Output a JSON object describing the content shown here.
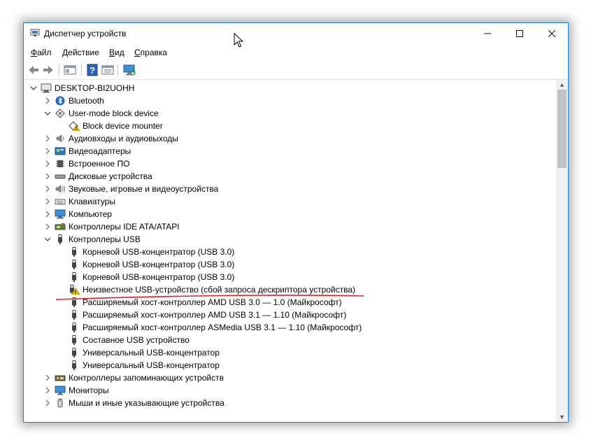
{
  "window": {
    "title": "Диспетчер устройств",
    "minimize_glyph": "—",
    "maximize_glyph": "☐",
    "close_glyph": "✕"
  },
  "menu": [
    {
      "label_pre": "",
      "label_u": "Ф",
      "label_post": "айл"
    },
    {
      "label_pre": "",
      "label_u": "Д",
      "label_post": "ействие"
    },
    {
      "label_pre": "",
      "label_u": "В",
      "label_post": "ид"
    },
    {
      "label_pre": "",
      "label_u": "С",
      "label_post": "правка"
    }
  ],
  "toolbar_icons": [
    "back-icon",
    "forward-icon",
    "properties-window-icon",
    "help-icon",
    "view-icon",
    "monitor-scan-icon"
  ],
  "tree": {
    "root": "DESKTOP-BI2UOHH",
    "items": [
      {
        "level": 1,
        "expander": "collapsed",
        "icon": "bluetooth-icon",
        "label": "Bluetooth"
      },
      {
        "level": 1,
        "expander": "expanded",
        "icon": "block-device-icon",
        "label": "User-mode block device"
      },
      {
        "level": 2,
        "expander": "none",
        "icon": "block-device-warning-icon",
        "label": "Block device mounter"
      },
      {
        "level": 1,
        "expander": "collapsed",
        "icon": "speaker-icon",
        "label": "Аудиовходы и аудиовыходы"
      },
      {
        "level": 1,
        "expander": "collapsed",
        "icon": "display-adapter-icon",
        "label": "Видеоадаптеры"
      },
      {
        "level": 1,
        "expander": "collapsed",
        "icon": "chip-icon",
        "label": "Встроенное ПО"
      },
      {
        "level": 1,
        "expander": "collapsed",
        "icon": "disk-drive-icon",
        "label": "Дисковые устройства"
      },
      {
        "level": 1,
        "expander": "collapsed",
        "icon": "sound-icon",
        "label": "Звуковые, игровые и видеоустройства"
      },
      {
        "level": 1,
        "expander": "collapsed",
        "icon": "keyboard-icon",
        "label": "Клавиатуры"
      },
      {
        "level": 1,
        "expander": "collapsed",
        "icon": "computer-icon",
        "label": "Компьютер"
      },
      {
        "level": 1,
        "expander": "collapsed",
        "icon": "ide-controller-icon",
        "label": "Контроллеры IDE ATA/ATAPI"
      },
      {
        "level": 1,
        "expander": "expanded",
        "icon": "usb-plug-icon",
        "label": "Контроллеры USB"
      },
      {
        "level": 2,
        "expander": "none",
        "icon": "usb-plug-icon",
        "label": "Корневой USB-концентратор (USB 3.0)"
      },
      {
        "level": 2,
        "expander": "none",
        "icon": "usb-plug-icon",
        "label": "Корневой USB-концентратор (USB 3.0)"
      },
      {
        "level": 2,
        "expander": "none",
        "icon": "usb-plug-icon",
        "label": "Корневой USB-концентратор (USB 3.0)"
      },
      {
        "level": 2,
        "expander": "none",
        "icon": "usb-warning-icon",
        "label": "Неизвестное USB-устройство (сбой запроса дескриптора устройства)"
      },
      {
        "level": 2,
        "expander": "none",
        "icon": "usb-plug-icon",
        "label": "Расширяемый хост-контроллер AMD USB 3.0 — 1.0 (Майкрософт)"
      },
      {
        "level": 2,
        "expander": "none",
        "icon": "usb-plug-icon",
        "label": "Расширяемый хост-контроллер AMD USB 3.1 — 1.10 (Майкрософт)"
      },
      {
        "level": 2,
        "expander": "none",
        "icon": "usb-plug-icon",
        "label": "Расширяемый хост-контроллер ASMedia USB 3.1 — 1.10 (Майкрософт)"
      },
      {
        "level": 2,
        "expander": "none",
        "icon": "usb-plug-icon",
        "label": "Составное USB устройство"
      },
      {
        "level": 2,
        "expander": "none",
        "icon": "usb-plug-icon",
        "label": "Универсальный USB-концентратор"
      },
      {
        "level": 2,
        "expander": "none",
        "icon": "usb-plug-icon",
        "label": "Универсальный USB-концентратор"
      },
      {
        "level": 1,
        "expander": "collapsed",
        "icon": "storage-controller-icon",
        "label": "Контроллеры запоминающих устройств"
      },
      {
        "level": 1,
        "expander": "collapsed",
        "icon": "monitor-icon",
        "label": "Мониторы"
      },
      {
        "level": 1,
        "expander": "collapsed",
        "icon": "mouse-icon",
        "label": "Мыши и иные указывающие устройства"
      }
    ]
  },
  "colors": {
    "window_border": "#1883d7",
    "annotation_red": "#e0202a",
    "warning_yellow": "#f2c200"
  }
}
